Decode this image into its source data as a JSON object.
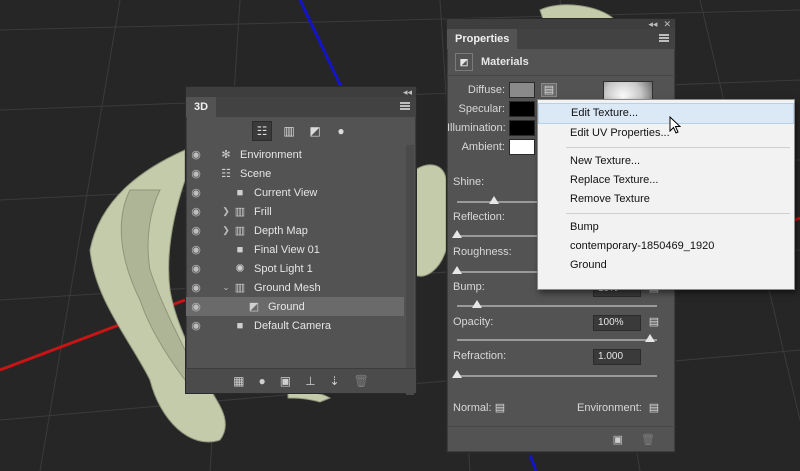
{
  "panel_3d": {
    "tab": "3D",
    "filters": [
      {
        "icon": "whole-scene-icon",
        "active": true
      },
      {
        "icon": "meshes-icon"
      },
      {
        "icon": "materials-icon"
      },
      {
        "icon": "lights-icon"
      }
    ],
    "items": [
      {
        "label": "Environment",
        "icon": "environment-icon",
        "indent": 0
      },
      {
        "label": "Scene",
        "icon": "scene-icon",
        "indent": 0
      },
      {
        "label": "Current View",
        "icon": "camera-icon",
        "indent": 1
      },
      {
        "label": "Frill",
        "icon": "mesh-icon",
        "indent": 1,
        "twirl": ">"
      },
      {
        "label": "Depth Map",
        "icon": "mesh-icon",
        "indent": 1,
        "twirl": ">"
      },
      {
        "label": "Final View 01",
        "icon": "camera-icon",
        "indent": 1
      },
      {
        "label": "Spot Light 1",
        "icon": "spot-light-icon",
        "indent": 1
      },
      {
        "label": "Ground Mesh",
        "icon": "mesh-icon",
        "indent": 1,
        "twirl": "v"
      },
      {
        "label": "Ground",
        "icon": "material-icon",
        "indent": 2,
        "selected": true
      },
      {
        "label": "Default Camera",
        "icon": "camera-icon",
        "indent": 1
      }
    ]
  },
  "properties": {
    "tab": "Properties",
    "section": "Materials",
    "diffuse_label": "Diffuse:",
    "specular_label": "Specular:",
    "illumination_label": "Illumination:",
    "ambient_label": "Ambient:",
    "shine_label": "Shine:",
    "reflection_label": "Reflection:",
    "roughness_label": "Roughness:",
    "bump_label": "Bump:",
    "bump_value": "10%",
    "opacity_label": "Opacity:",
    "opacity_value": "100%",
    "refraction_label": "Refraction:",
    "refraction_value": "1.000",
    "normal_label": "Normal:",
    "environment_label": "Environment:",
    "colors": {
      "diffuse": "#8a8a8a",
      "specular": "#000000",
      "illumination": "#000000",
      "ambient": "#ffffff"
    },
    "slider_levels": {
      "shine": 0.2,
      "reflection": 0.0,
      "roughness": 0.0,
      "bump": 0.1,
      "opacity": 1.0,
      "refraction": 0.0
    }
  },
  "context_menu": {
    "items": [
      "Edit Texture...",
      "Edit UV Properties...",
      "New Texture...",
      "Replace Texture...",
      "Remove Texture",
      "Bump",
      "contemporary-1850469_1920",
      "Ground"
    ],
    "highlighted_index": 0
  },
  "viewport": {
    "x_axis_color": "#d01010",
    "y_axis_color": "#1010d0",
    "model_color": "#c9d0b1"
  }
}
